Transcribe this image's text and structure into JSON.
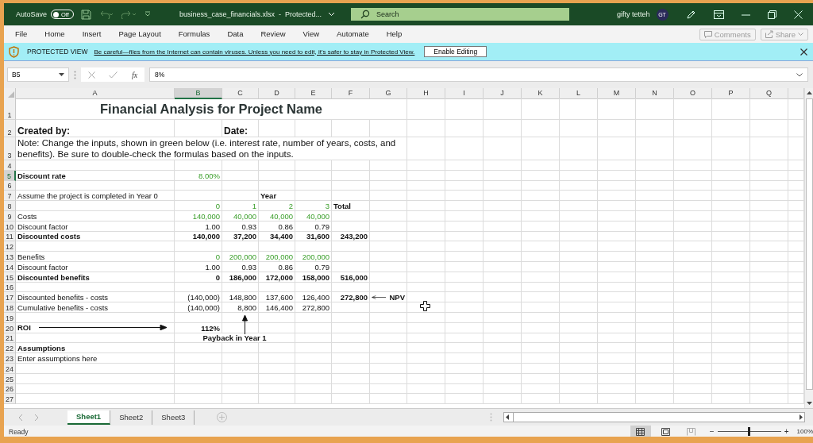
{
  "window": {
    "autosave_label": "AutoSave",
    "autosave_toggle": {
      "label": "Off",
      "on": false
    },
    "title": "business_case_financials.xlsx  -  Protected...",
    "search": {
      "placeholder": "Search"
    },
    "user_name": "gifty tetteh",
    "avatar_initials": "GT"
  },
  "ribbon": {
    "tabs": [
      {
        "label": "File",
        "selected": false
      },
      {
        "label": "Home",
        "selected": false
      },
      {
        "label": "Insert",
        "selected": false
      },
      {
        "label": "Page Layout",
        "selected": false
      },
      {
        "label": "Formulas",
        "selected": false
      },
      {
        "label": "Data",
        "selected": false
      },
      {
        "label": "Review",
        "selected": false
      },
      {
        "label": "View",
        "selected": false
      },
      {
        "label": "Automate",
        "selected": false
      },
      {
        "label": "Help",
        "selected": false
      }
    ],
    "buttons": [
      {
        "label": "Comments",
        "kind": "comments",
        "disabled": true
      },
      {
        "label": "Share",
        "kind": "share",
        "disabled": true
      }
    ]
  },
  "protected_view": {
    "label": "PROTECTED VIEW",
    "message": "Be careful—files from the Internet can contain viruses. Unless you need to edit, it's safer to stay in Protected View.",
    "button": "Enable Editing"
  },
  "formula_bar": {
    "name_box": "B5",
    "function_label": "fx",
    "formula": "8%"
  },
  "sheet": {
    "columns": [
      {
        "label": "A",
        "selected": false
      },
      {
        "label": "B",
        "selected": true
      },
      {
        "label": "C",
        "selected": false
      },
      {
        "label": "D",
        "selected": false
      },
      {
        "label": "E",
        "selected": false
      },
      {
        "label": "F",
        "selected": false
      },
      {
        "label": "G",
        "selected": false
      },
      {
        "label": "H",
        "selected": false
      },
      {
        "label": "I",
        "selected": false
      },
      {
        "label": "J",
        "selected": false
      },
      {
        "label": "K",
        "selected": false
      },
      {
        "label": "L",
        "selected": false
      },
      {
        "label": "M",
        "selected": false
      },
      {
        "label": "N",
        "selected": false
      },
      {
        "label": "O",
        "selected": false
      },
      {
        "label": "P",
        "selected": false
      },
      {
        "label": "Q",
        "selected": false
      }
    ],
    "rows": [
      {
        "number": "1",
        "selected": false,
        "cells": {
          "A": {
            "text": "Financial Analysis for Project Name",
            "kind": "title"
          }
        }
      },
      {
        "number": "2",
        "selected": false,
        "cells": {
          "A": {
            "text": "Created by:",
            "kind": "subheading"
          },
          "C": {
            "text": "Date:",
            "kind": "subheading"
          }
        }
      },
      {
        "number": "3",
        "selected": false,
        "cells": {
          "A": {
            "text": "Note: Change the inputs, shown in green below (i.e. interest rate, number of years, costs, and benefits). Be sure to double-check the formulas based on the inputs.",
            "kind": "note"
          }
        }
      },
      {
        "number": "4",
        "selected": false
      },
      {
        "number": "5",
        "selected": true,
        "cells": {
          "A": {
            "text": "Discount rate",
            "kind": "heading"
          },
          "B": {
            "text": "8.00%",
            "kind": "input"
          }
        }
      },
      {
        "number": "6",
        "selected": false
      },
      {
        "number": "7",
        "selected": false,
        "cells": {
          "A": {
            "text": "Assume the project is completed in Year 0",
            "kind": "text"
          },
          "D": {
            "text": "Year",
            "kind": "heading"
          }
        }
      },
      {
        "number": "8",
        "selected": false,
        "cells": {
          "B": {
            "text": "0",
            "kind": "input"
          },
          "C": {
            "text": "1",
            "kind": "input"
          },
          "D": {
            "text": "2",
            "kind": "input"
          },
          "E": {
            "text": "3",
            "kind": "input"
          },
          "F": {
            "text": "Total",
            "kind": "heading"
          }
        }
      },
      {
        "number": "9",
        "selected": false,
        "cells": {
          "A": {
            "text": "Costs",
            "kind": "text"
          },
          "B": {
            "text": "140,000",
            "kind": "input"
          },
          "C": {
            "text": "40,000",
            "kind": "input"
          },
          "D": {
            "text": "40,000",
            "kind": "input"
          },
          "E": {
            "text": "40,000",
            "kind": "input"
          }
        }
      },
      {
        "number": "10",
        "selected": false,
        "cells": {
          "A": {
            "text": "Discount factor",
            "kind": "text"
          },
          "B": {
            "text": "1.00",
            "kind": "value"
          },
          "C": {
            "text": "0.93",
            "kind": "value"
          },
          "D": {
            "text": "0.86",
            "kind": "value"
          },
          "E": {
            "text": "0.79",
            "kind": "value"
          }
        }
      },
      {
        "number": "11",
        "selected": false,
        "cells": {
          "A": {
            "text": "Discounted costs",
            "kind": "heading"
          },
          "B": {
            "text": "140,000",
            "kind": "total"
          },
          "C": {
            "text": "37,200",
            "kind": "total"
          },
          "D": {
            "text": "34,400",
            "kind": "total"
          },
          "E": {
            "text": "31,600",
            "kind": "total"
          },
          "F": {
            "text": "243,200",
            "kind": "total"
          }
        }
      },
      {
        "number": "12",
        "selected": false
      },
      {
        "number": "13",
        "selected": false,
        "cells": {
          "A": {
            "text": "Benefits",
            "kind": "text"
          },
          "B": {
            "text": "0",
            "kind": "input"
          },
          "C": {
            "text": "200,000",
            "kind": "input"
          },
          "D": {
            "text": "200,000",
            "kind": "input"
          },
          "E": {
            "text": "200,000",
            "kind": "input"
          }
        }
      },
      {
        "number": "14",
        "selected": false,
        "cells": {
          "A": {
            "text": "Discount factor",
            "kind": "text"
          },
          "B": {
            "text": "1.00",
            "kind": "value"
          },
          "C": {
            "text": "0.93",
            "kind": "value"
          },
          "D": {
            "text": "0.86",
            "kind": "value"
          },
          "E": {
            "text": "0.79",
            "kind": "value"
          }
        }
      },
      {
        "number": "15",
        "selected": false,
        "cells": {
          "A": {
            "text": "Discounted benefits",
            "kind": "heading"
          },
          "B": {
            "text": "0",
            "kind": "total"
          },
          "C": {
            "text": "186,000",
            "kind": "total"
          },
          "D": {
            "text": "172,000",
            "kind": "total"
          },
          "E": {
            "text": "158,000",
            "kind": "total"
          },
          "F": {
            "text": "516,000",
            "kind": "total"
          }
        }
      },
      {
        "number": "16",
        "selected": false
      },
      {
        "number": "17",
        "selected": false,
        "cells": {
          "A": {
            "text": "Discounted benefits - costs",
            "kind": "text"
          },
          "B": {
            "text": "(140,000)",
            "kind": "value"
          },
          "C": {
            "text": "148,800",
            "kind": "value"
          },
          "D": {
            "text": "137,600",
            "kind": "value"
          },
          "E": {
            "text": "126,400",
            "kind": "value"
          },
          "F": {
            "text": "272,800",
            "kind": "total"
          },
          "G": {
            "text": "NPV",
            "kind": "pointer_label"
          }
        }
      },
      {
        "number": "18",
        "selected": false,
        "cells": {
          "A": {
            "text": "Cumulative benefits - costs",
            "kind": "text"
          },
          "B": {
            "text": "(140,000)",
            "kind": "value"
          },
          "C": {
            "text": "8,800",
            "kind": "value"
          },
          "D": {
            "text": "146,400",
            "kind": "value"
          },
          "E": {
            "text": "272,800",
            "kind": "value"
          }
        }
      },
      {
        "number": "19",
        "selected": false
      },
      {
        "number": "20",
        "selected": false,
        "cells": {
          "A": {
            "text": "ROI",
            "kind": "arrow_label"
          },
          "B": {
            "text": "112%",
            "kind": "total"
          }
        }
      },
      {
        "number": "21",
        "selected": false,
        "cells": {
          "B": {
            "text": "Payback in Year 1",
            "kind": "caption"
          }
        }
      },
      {
        "number": "22",
        "selected": false,
        "cells": {
          "A": {
            "text": "Assumptions",
            "kind": "heading"
          }
        }
      },
      {
        "number": "23",
        "selected": false,
        "cells": {
          "A": {
            "text": "Enter assumptions here",
            "kind": "text"
          }
        }
      },
      {
        "number": "24",
        "selected": false
      },
      {
        "number": "25",
        "selected": false
      },
      {
        "number": "26",
        "selected": false
      },
      {
        "number": "27",
        "selected": false
      }
    ]
  },
  "sheet_tabs": [
    {
      "label": "Sheet1",
      "selected": true
    },
    {
      "label": "Sheet2",
      "selected": false
    },
    {
      "label": "Sheet3",
      "selected": false
    }
  ],
  "status_bar": {
    "status": "Ready",
    "views": [
      {
        "kind": "normal",
        "selected": true
      },
      {
        "kind": "page_layout",
        "selected": false
      },
      {
        "kind": "page_break",
        "selected": false
      }
    ],
    "zoom": {
      "minus": "−",
      "plus": "+",
      "level": 0.5,
      "reading": "100%"
    }
  }
}
